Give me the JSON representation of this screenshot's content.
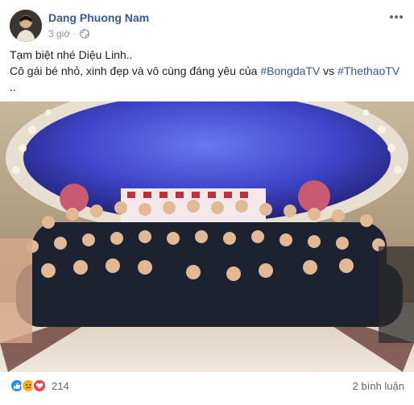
{
  "post": {
    "author": "Dang Phuong Nam",
    "time": "3 giờ",
    "separator": "·",
    "text_line1": "Tạm biệt nhé Diệu Linh..",
    "text_line2_prefix": "Cô gái bé nhỏ, xinh đẹp và vô cùng đáng yêu của ",
    "hashtag1": "#BongdaTV",
    "text_between": " vs ",
    "hashtag2": "#ThethaoTV",
    "text_line3": "..",
    "reaction_icons": [
      "like-icon",
      "sad-icon",
      "love-icon"
    ],
    "reaction_count": "214",
    "comments": "2 bình luận"
  },
  "colors": {
    "author_link": "#385898",
    "like": "#2d88ff",
    "sad": "#f7b125",
    "love": "#f33e58",
    "meta": "#90949c"
  }
}
